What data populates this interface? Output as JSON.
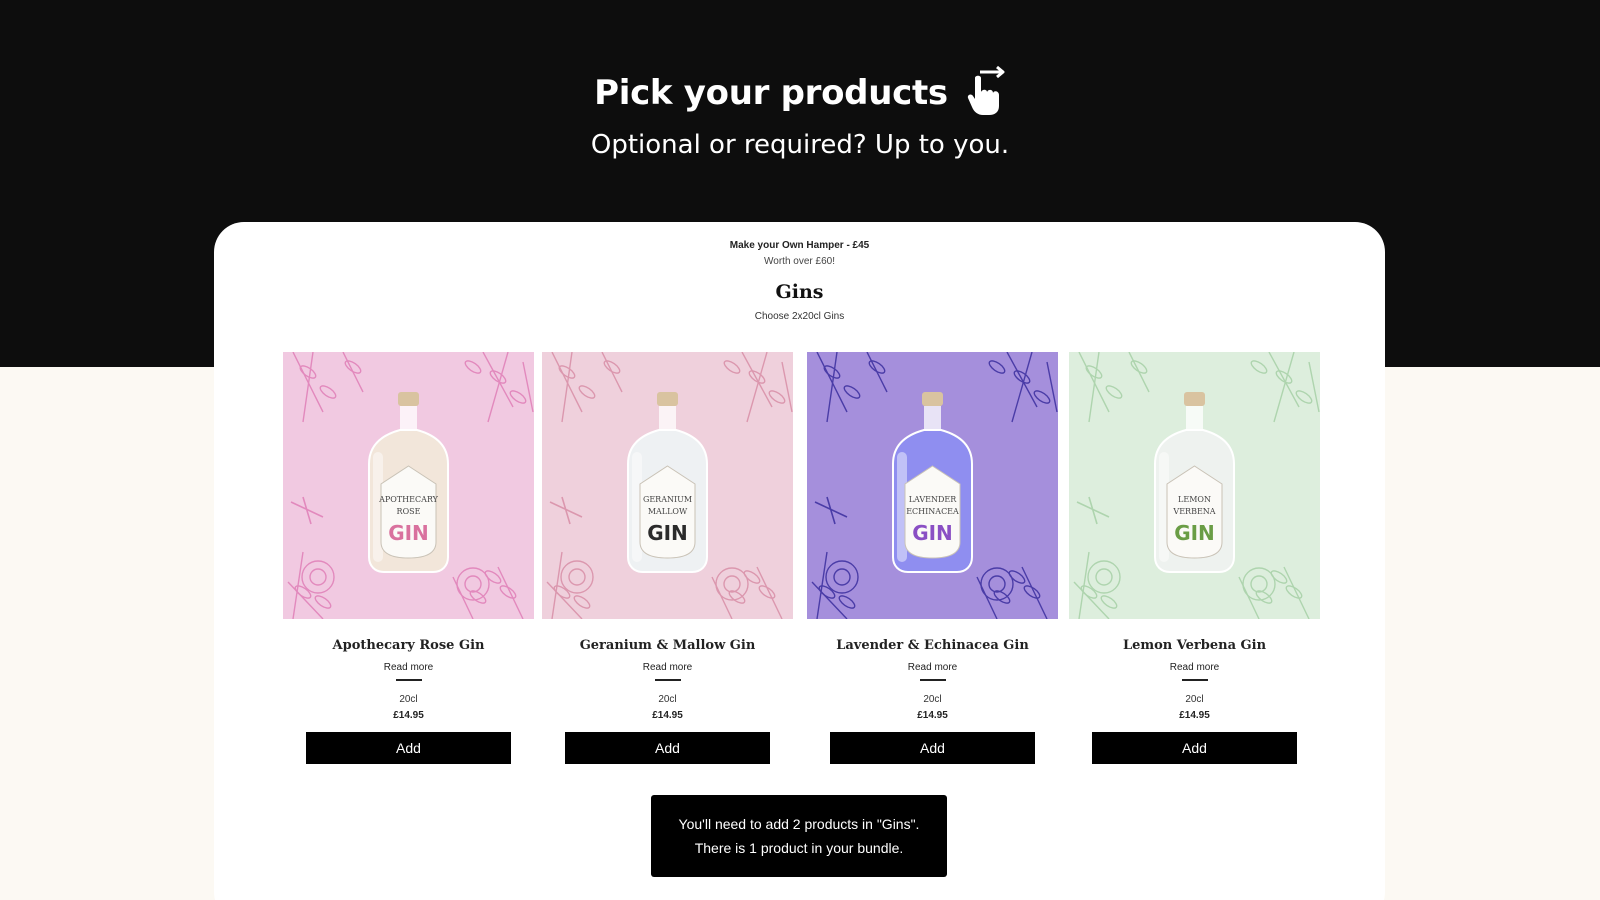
{
  "hero": {
    "title": "Pick your products",
    "subtitle": "Optional or required? Up to you.",
    "icon": "pointing-hand-icon"
  },
  "bundle": {
    "title": "Make your Own Hamper - £45",
    "subtitle": "Worth over £60!"
  },
  "section": {
    "title": "Gins",
    "subtitle": "Choose 2x20cl Gins"
  },
  "products": [
    {
      "name": "Apothecary Rose Gin",
      "read_more": "Read more",
      "size": "20cl",
      "price": "£14.95",
      "add_label": "Add",
      "bg_color": "#f1c9e1",
      "flora_color": "#e07fb7",
      "liquid_color": "#f2e6da",
      "label_lines": [
        "APOTHECARY",
        "ROSE"
      ],
      "gin_color": "#d9719e"
    },
    {
      "name": "Geranium & Mallow Gin",
      "read_more": "Read more",
      "size": "20cl",
      "price": "£14.95",
      "add_label": "Add",
      "bg_color": "#efd0dc",
      "flora_color": "#d88ea6",
      "liquid_color": "#eef1f3",
      "label_lines": [
        "GERANIUM",
        "MALLOW"
      ],
      "gin_color": "#2b2b2b"
    },
    {
      "name": "Lavender & Echinacea Gin",
      "read_more": "Read more",
      "size": "20cl",
      "price": "£14.95",
      "add_label": "Add",
      "bg_color": "#a58fdc",
      "flora_color": "#3b2e9e",
      "liquid_color": "#8f8ef0",
      "label_lines": [
        "LAVENDER",
        "ECHINACEA"
      ],
      "gin_color": "#8a4fc4"
    },
    {
      "name": "Lemon Verbena Gin",
      "read_more": "Read more",
      "size": "20cl",
      "price": "£14.95",
      "add_label": "Add",
      "bg_color": "#ddeedd",
      "flora_color": "#a6d0a6",
      "liquid_color": "#eef2ef",
      "label_lines": [
        "LEMON",
        "VERBENA"
      ],
      "gin_color": "#6a9d45"
    }
  ],
  "notice": {
    "line1": "You'll need to add 2 products in \"Gins\".",
    "line2": "There is 1 product in your bundle."
  }
}
